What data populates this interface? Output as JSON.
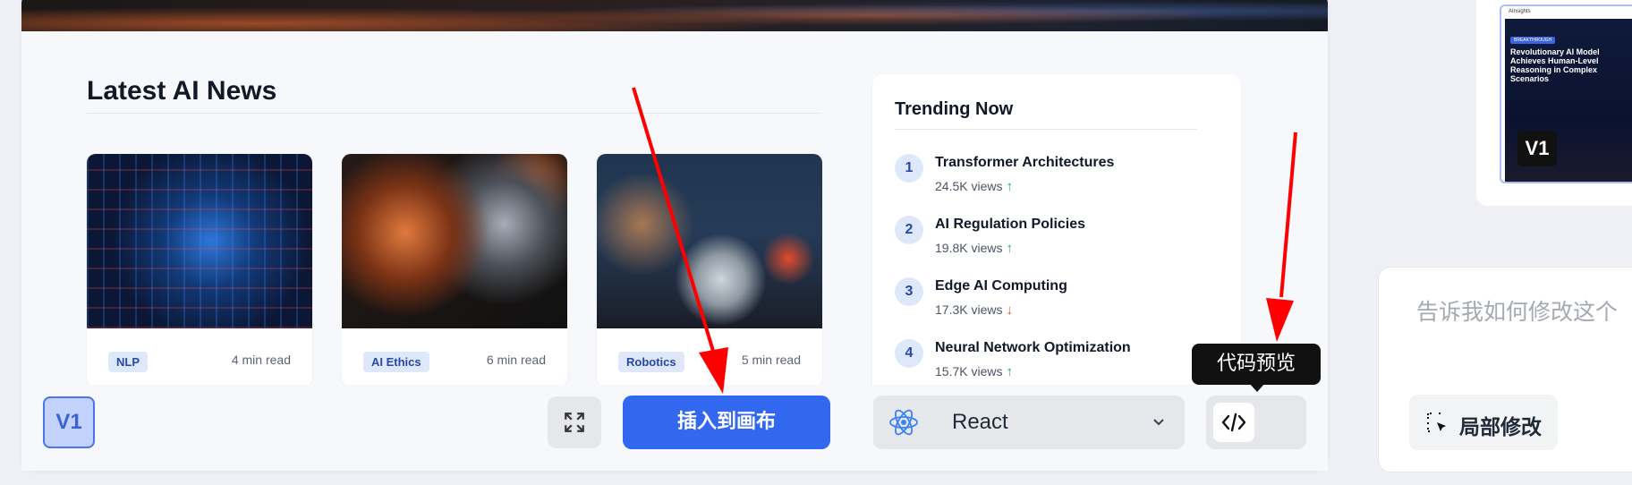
{
  "latest": {
    "title": "Latest AI News",
    "cards": [
      {
        "tag": "NLP",
        "read": "4 min read"
      },
      {
        "tag": "AI Ethics",
        "read": "6 min read"
      },
      {
        "tag": "Robotics",
        "read": "5 min read"
      }
    ]
  },
  "trending": {
    "title": "Trending Now",
    "items": [
      {
        "num": "1",
        "name": "Transformer Architectures",
        "views": "24.5K views",
        "trend": "up"
      },
      {
        "num": "2",
        "name": "AI Regulation Policies",
        "views": "19.8K views",
        "trend": "up"
      },
      {
        "num": "3",
        "name": "Edge AI Computing",
        "views": "17.3K views",
        "trend": "down"
      },
      {
        "num": "4",
        "name": "Neural Network Optimization",
        "views": "15.7K views",
        "trend": "up"
      }
    ]
  },
  "toolbar": {
    "version": "V1",
    "insert_label": "插入到画布",
    "framework": "React",
    "code_preview_tooltip": "代码预览"
  },
  "thumbnail": {
    "logo": "AInsights",
    "tag": "BREAKTHROUGH",
    "headline": "Revolutionary AI Model Achieves Human-Level Reasoning in Complex Scenarios",
    "version": "V1"
  },
  "prompt": {
    "placeholder": "告诉我如何修改这个",
    "partial_edit": "局部修改"
  },
  "colors": {
    "accent": "#3268f0",
    "trend_up": "#22a35a",
    "trend_down": "#e0453a",
    "annotation_arrow": "#ff0000"
  }
}
